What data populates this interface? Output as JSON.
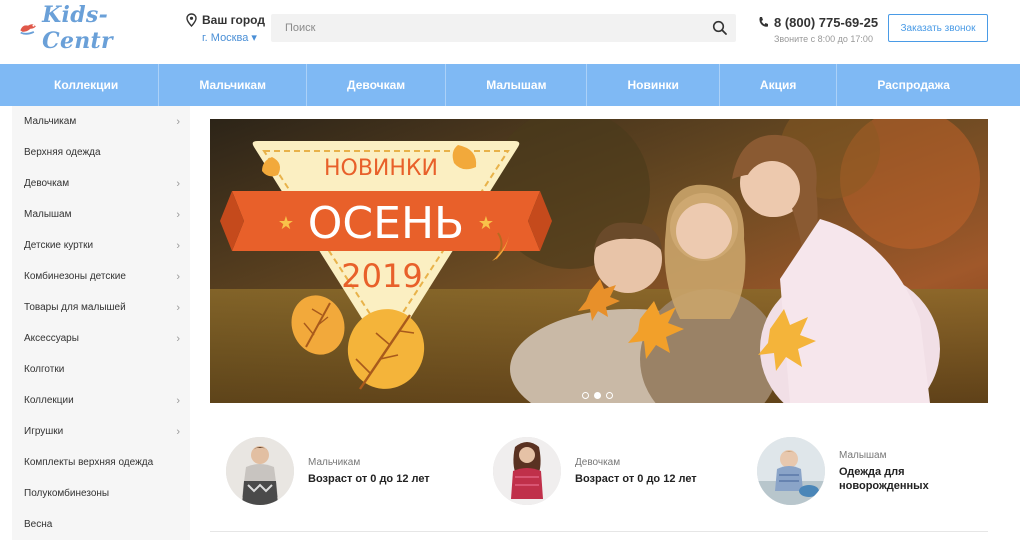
{
  "header": {
    "logo_text": "Kids-Centr",
    "city_title": "Ваш город",
    "city_name": "г. Москва ▾",
    "search_placeholder": "Поиск",
    "phone": "8 (800) 775-69-25",
    "phone_hours": "Звоните с 8:00 до 17:00",
    "callback_label": "Заказать звонок"
  },
  "nav": {
    "items": [
      "Коллекции",
      "Мальчикам",
      "Девочкам",
      "Малышам",
      "Новинки",
      "Акция",
      "Распродажа"
    ]
  },
  "sidebar": {
    "items": [
      {
        "label": "Мальчикам",
        "has_arrow": true
      },
      {
        "label": "Верхняя одежда",
        "has_arrow": false
      },
      {
        "label": "Девочкам",
        "has_arrow": true
      },
      {
        "label": "Малышам",
        "has_arrow": true
      },
      {
        "label": "Детские куртки",
        "has_arrow": true
      },
      {
        "label": "Комбинезоны детские",
        "has_arrow": true
      },
      {
        "label": "Товары для малышей",
        "has_arrow": true
      },
      {
        "label": "Аксессуары",
        "has_arrow": true
      },
      {
        "label": "Колготки",
        "has_arrow": false
      },
      {
        "label": "Коллекции",
        "has_arrow": true
      },
      {
        "label": "Игрушки",
        "has_arrow": true
      },
      {
        "label": "Комплекты верхняя одежда",
        "has_arrow": false
      },
      {
        "label": "Полукомбинезоны",
        "has_arrow": false
      },
      {
        "label": "Весна",
        "has_arrow": false
      }
    ]
  },
  "banner": {
    "badge_top": "НОВИНКИ",
    "badge_main": "ОСЕНЬ",
    "badge_year": "2019",
    "slide_count": 3,
    "active_slide": 2
  },
  "categories": [
    {
      "subtitle": "Мальчикам",
      "title": "Возраст от 0 до 12 лет"
    },
    {
      "subtitle": "Девочкам",
      "title": "Возраст от 0 до 12 лет"
    },
    {
      "subtitle": "Малышам",
      "title": "Одежда для новорожденных"
    }
  ],
  "colors": {
    "nav_bg": "#7fb9f4",
    "accent": "#4a9be6",
    "badge_orange": "#e8602a",
    "badge_cream": "#fbefc2",
    "leaf": "#f2a93b"
  }
}
